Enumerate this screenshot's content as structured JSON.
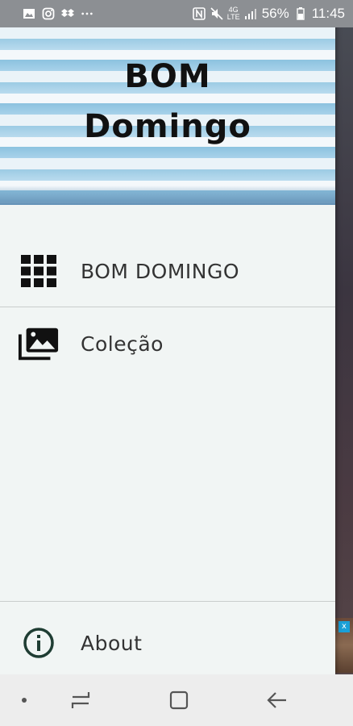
{
  "status_bar": {
    "network_type": "4G",
    "network_sub": "LTE",
    "battery": "56%",
    "time": "11:45",
    "left_icons": [
      "image-icon",
      "instagram-icon",
      "dropbox-icon",
      "more-dots-icon"
    ],
    "right_icons": [
      "nfc-icon",
      "mute-icon",
      "signal-icon",
      "battery-icon"
    ]
  },
  "drawer": {
    "header": {
      "title_line1": "BOM",
      "title_line2": "Domingo"
    },
    "items": [
      {
        "label": "BOM DOMINGO",
        "icon": "grid-icon"
      },
      {
        "label": "Coleção",
        "icon": "photo-library-icon"
      }
    ],
    "footer_item": {
      "label": "About",
      "icon": "info-icon"
    }
  },
  "navigation_bar": {
    "buttons": [
      "dot-icon",
      "recent-apps-icon",
      "home-icon",
      "back-icon"
    ]
  },
  "colors": {
    "drawer_bg": "#f1f5f4",
    "icon_dark": "#111111",
    "info_icon": "#1f3d33",
    "label_text": "#333333",
    "status_bar_bg": "#8c8f93",
    "nav_bar_bg": "#ededed"
  }
}
